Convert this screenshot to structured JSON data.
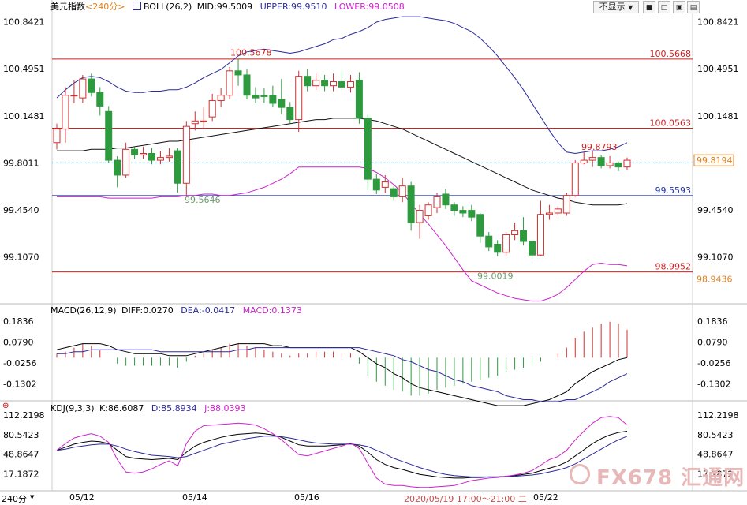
{
  "header": {
    "symbol": "美元指数",
    "period": "<240分>",
    "indicator": "BOLL(26,2)",
    "mid": "MID:99.5009",
    "upper": "UPPER:99.9510",
    "lower": "LOWER:99.0508"
  },
  "controls": {
    "dropdown_label": "不显示",
    "btn_a": "■",
    "btn_b": "□",
    "btn_c": "▣",
    "btn_d": "▤"
  },
  "main_axis": {
    "left_ticks": [
      "100.8421",
      "100.4951",
      "100.1481",
      "99.8011",
      "99.4540",
      "99.1070"
    ],
    "right_ticks": [
      "100.8421",
      "100.4951",
      "100.1481",
      "99.8011",
      "99.4540",
      "99.1070"
    ],
    "current_price": "99.8194",
    "lower_price": "98.9436"
  },
  "annotations": {
    "high": "100.5678",
    "low1": "99.5646",
    "low2": "99.0019",
    "peak": "99.8793",
    "line_100_5668": "100.5668",
    "line_100_0563": "100.0563",
    "line_99_5593": "99.5593",
    "line_98_9952": "98.9952"
  },
  "macd": {
    "title": "MACD(26,12,9)",
    "diff": "DIFF:0.0270",
    "dea": "DEA:-0.0417",
    "macd": "MACD:0.1373",
    "ticks": [
      "0.1836",
      "0.0790",
      "-0.0256",
      "-0.1302"
    ]
  },
  "kdj": {
    "title": "KDJ(9,3,3)",
    "k": "K:86.6087",
    "d": "D:85.8934",
    "j": "J:88.0393",
    "ticks": [
      "112.2198",
      "80.5423",
      "48.8647",
      "17.1872"
    ]
  },
  "time_axis": {
    "period": "240分",
    "labels": [
      "05/12",
      "05/14",
      "05/16",
      "05/22"
    ],
    "cursor_time": "2020/05/19 17:00～21:00 二"
  },
  "watermark": "FX678 汇通网",
  "colors": {
    "up": "#d03030",
    "down": "#2e9a3e",
    "upper_band": "#2a2a9a",
    "lower_band": "#cc22cc",
    "mid_band": "#111111",
    "level_red": "#cc2222",
    "level_blue": "#2233aa",
    "current": "#e08020"
  },
  "chart_data": {
    "type": "candlestick",
    "price_axis": {
      "min": 98.76,
      "max": 100.91
    },
    "candles": [
      [
        99.95,
        100.05,
        99.9,
        100.09
      ],
      [
        100.05,
        100.3,
        99.95,
        100.36
      ],
      [
        100.3,
        100.3,
        100.24,
        100.41
      ],
      [
        100.28,
        100.42,
        100.24,
        100.45
      ],
      [
        100.42,
        100.32,
        100.29,
        100.46
      ],
      [
        100.32,
        100.22,
        100.15,
        100.36
      ],
      [
        100.18,
        99.82,
        99.8,
        100.22
      ],
      [
        99.82,
        99.71,
        99.62,
        99.85
      ],
      [
        99.71,
        99.9,
        99.69,
        99.95
      ],
      [
        99.9,
        99.86,
        99.83,
        99.92
      ],
      [
        99.86,
        99.87,
        99.83,
        99.92
      ],
      [
        99.87,
        99.82,
        99.79,
        99.91
      ],
      [
        99.82,
        99.84,
        99.79,
        99.89
      ],
      [
        99.84,
        99.85,
        99.81,
        99.91
      ],
      [
        99.89,
        99.65,
        99.58,
        99.91
      ],
      [
        99.65,
        100.07,
        99.56,
        100.11
      ],
      [
        100.09,
        100.11,
        100.04,
        100.18
      ],
      [
        100.11,
        100.11,
        100.06,
        100.21
      ],
      [
        100.14,
        100.26,
        100.11,
        100.31
      ],
      [
        100.26,
        100.3,
        100.21,
        100.35
      ],
      [
        100.3,
        100.48,
        100.27,
        100.51
      ],
      [
        100.48,
        100.45,
        100.37,
        100.57
      ],
      [
        100.45,
        100.3,
        100.27,
        100.49
      ],
      [
        100.3,
        100.28,
        100.24,
        100.36
      ],
      [
        100.3,
        100.29,
        100.24,
        100.35
      ],
      [
        100.3,
        100.24,
        100.21,
        100.37
      ],
      [
        100.27,
        100.21,
        100.16,
        100.42
      ],
      [
        100.21,
        100.12,
        100.09,
        100.25
      ],
      [
        100.12,
        100.44,
        100.03,
        100.48
      ],
      [
        100.44,
        100.37,
        100.33,
        100.49
      ],
      [
        100.37,
        100.41,
        100.34,
        100.46
      ],
      [
        100.41,
        100.37,
        100.33,
        100.45
      ],
      [
        100.37,
        100.4,
        100.33,
        100.46
      ],
      [
        100.4,
        100.36,
        100.34,
        100.49
      ],
      [
        100.36,
        100.4,
        100.32,
        100.45
      ],
      [
        100.41,
        100.13,
        100.09,
        100.47
      ],
      [
        100.13,
        99.68,
        99.6,
        100.16
      ],
      [
        99.68,
        99.6,
        99.57,
        99.72
      ],
      [
        99.62,
        99.66,
        99.58,
        99.71
      ],
      [
        99.61,
        99.55,
        99.52,
        99.63
      ],
      [
        99.55,
        99.63,
        99.51,
        99.69
      ],
      [
        99.63,
        99.36,
        99.3,
        99.66
      ],
      [
        99.36,
        99.45,
        99.24,
        99.49
      ],
      [
        99.41,
        99.49,
        99.38,
        99.51
      ],
      [
        99.47,
        99.55,
        99.43,
        99.58
      ],
      [
        99.57,
        99.49,
        99.46,
        99.61
      ],
      [
        99.49,
        99.45,
        99.41,
        99.51
      ],
      [
        99.45,
        99.43,
        99.4,
        99.48
      ],
      [
        99.45,
        99.4,
        99.37,
        99.49
      ],
      [
        99.42,
        99.26,
        99.21,
        99.43
      ],
      [
        99.26,
        99.18,
        99.15,
        99.29
      ],
      [
        99.2,
        99.14,
        99.11,
        99.23
      ],
      [
        99.14,
        99.27,
        99.11,
        99.29
      ],
      [
        99.27,
        99.3,
        99.23,
        99.36
      ],
      [
        99.3,
        99.22,
        99.19,
        99.4
      ],
      [
        99.22,
        99.12,
        99.09,
        99.23
      ],
      [
        99.12,
        99.42,
        99.11,
        99.52
      ],
      [
        99.42,
        99.43,
        99.38,
        99.49
      ],
      [
        99.43,
        99.46,
        99.41,
        99.48
      ],
      [
        99.43,
        99.56,
        99.41,
        99.58
      ],
      [
        99.56,
        99.8,
        99.55,
        99.82
      ],
      [
        99.8,
        99.82,
        99.79,
        99.88
      ],
      [
        99.82,
        99.84,
        99.77,
        99.89
      ],
      [
        99.84,
        99.78,
        99.76,
        99.86
      ],
      [
        99.78,
        99.8,
        99.76,
        99.85
      ],
      [
        99.8,
        99.77,
        99.74,
        99.81
      ],
      [
        99.77,
        99.82,
        99.75,
        99.84
      ]
    ],
    "upper_band": [
      100.28,
      100.34,
      100.39,
      100.43,
      100.44,
      100.43,
      100.4,
      100.36,
      100.33,
      100.32,
      100.32,
      100.33,
      100.33,
      100.34,
      100.34,
      100.36,
      100.39,
      100.43,
      100.46,
      100.49,
      100.54,
      100.59,
      100.62,
      100.63,
      100.64,
      100.63,
      100.62,
      100.61,
      100.62,
      100.64,
      100.66,
      100.68,
      100.71,
      100.72,
      100.75,
      100.77,
      100.8,
      100.84,
      100.86,
      100.87,
      100.88,
      100.88,
      100.88,
      100.87,
      100.86,
      100.85,
      100.83,
      100.8,
      100.77,
      100.72,
      100.66,
      100.59,
      100.51,
      100.43,
      100.34,
      100.24,
      100.14,
      100.04,
      99.95,
      99.88,
      99.87,
      99.88,
      99.89,
      99.89,
      99.9,
      99.92,
      99.95
    ],
    "mid_band": [
      99.89,
      99.89,
      99.89,
      99.89,
      99.9,
      99.9,
      99.9,
      99.91,
      99.91,
      99.92,
      99.93,
      99.94,
      99.95,
      99.96,
      99.96,
      99.97,
      99.98,
      99.99,
      100.0,
      100.01,
      100.02,
      100.03,
      100.04,
      100.05,
      100.06,
      100.07,
      100.08,
      100.09,
      100.1,
      100.11,
      100.12,
      100.12,
      100.13,
      100.13,
      100.13,
      100.13,
      100.12,
      100.11,
      100.09,
      100.07,
      100.05,
      100.02,
      99.99,
      99.96,
      99.93,
      99.9,
      99.87,
      99.84,
      99.81,
      99.78,
      99.75,
      99.72,
      99.69,
      99.66,
      99.63,
      99.6,
      99.58,
      99.56,
      99.54,
      99.53,
      99.51,
      99.5,
      99.49,
      99.49,
      99.49,
      99.49,
      99.5
    ],
    "lower_band": [
      99.55,
      99.55,
      99.55,
      99.55,
      99.55,
      99.55,
      99.54,
      99.54,
      99.54,
      99.54,
      99.54,
      99.54,
      99.55,
      99.55,
      99.55,
      99.56,
      99.56,
      99.57,
      99.57,
      99.56,
      99.56,
      99.57,
      99.58,
      99.6,
      99.62,
      99.65,
      99.68,
      99.72,
      99.77,
      99.77,
      99.77,
      99.77,
      99.77,
      99.77,
      99.77,
      99.77,
      99.76,
      99.73,
      99.69,
      99.64,
      99.58,
      99.5,
      99.42,
      99.35,
      99.27,
      99.19,
      99.1,
      99.01,
      98.93,
      98.9,
      98.87,
      98.84,
      98.82,
      98.8,
      98.79,
      98.78,
      98.78,
      98.8,
      98.83,
      98.88,
      98.94,
      99.0,
      99.05,
      99.06,
      99.05,
      99.05,
      99.04
    ],
    "macd_hist": [
      0.02,
      0.03,
      0.05,
      0.07,
      0.06,
      0.04,
      0.0,
      -0.03,
      -0.04,
      -0.04,
      -0.04,
      -0.04,
      -0.04,
      -0.04,
      -0.05,
      -0.02,
      0.01,
      0.02,
      0.04,
      0.05,
      0.07,
      0.07,
      0.06,
      0.05,
      0.04,
      0.03,
      0.02,
      0.01,
      0.02,
      0.02,
      0.03,
      0.03,
      0.03,
      0.02,
      0.02,
      -0.03,
      -0.09,
      -0.12,
      -0.14,
      -0.16,
      -0.17,
      -0.19,
      -0.19,
      -0.18,
      -0.16,
      -0.15,
      -0.14,
      -0.13,
      -0.12,
      -0.11,
      -0.1,
      -0.09,
      -0.07,
      -0.06,
      -0.05,
      -0.04,
      -0.02,
      0.0,
      0.02,
      0.05,
      0.1,
      0.13,
      0.15,
      0.17,
      0.18,
      0.17,
      0.14
    ],
    "macd_diff": [
      0.04,
      0.05,
      0.06,
      0.07,
      0.07,
      0.07,
      0.06,
      0.04,
      0.03,
      0.02,
      0.02,
      0.02,
      0.02,
      0.01,
      0.01,
      0.01,
      0.02,
      0.03,
      0.04,
      0.05,
      0.06,
      0.07,
      0.07,
      0.07,
      0.07,
      0.06,
      0.06,
      0.05,
      0.05,
      0.05,
      0.05,
      0.05,
      0.05,
      0.05,
      0.05,
      0.03,
      0.0,
      -0.03,
      -0.05,
      -0.08,
      -0.1,
      -0.13,
      -0.15,
      -0.16,
      -0.17,
      -0.18,
      -0.19,
      -0.2,
      -0.21,
      -0.22,
      -0.23,
      -0.24,
      -0.24,
      -0.24,
      -0.24,
      -0.23,
      -0.22,
      -0.21,
      -0.19,
      -0.17,
      -0.13,
      -0.1,
      -0.07,
      -0.05,
      -0.03,
      -0.01,
      0.0
    ],
    "macd_dea": [
      0.02,
      0.02,
      0.03,
      0.03,
      0.04,
      0.04,
      0.04,
      0.04,
      0.04,
      0.04,
      0.04,
      0.04,
      0.03,
      0.03,
      0.03,
      0.03,
      0.03,
      0.03,
      0.03,
      0.03,
      0.03,
      0.04,
      0.04,
      0.05,
      0.05,
      0.05,
      0.05,
      0.05,
      0.05,
      0.05,
      0.05,
      0.05,
      0.05,
      0.05,
      0.05,
      0.05,
      0.04,
      0.03,
      0.02,
      0.01,
      -0.01,
      -0.02,
      -0.04,
      -0.06,
      -0.07,
      -0.09,
      -0.11,
      -0.12,
      -0.14,
      -0.15,
      -0.16,
      -0.17,
      -0.19,
      -0.2,
      -0.21,
      -0.21,
      -0.22,
      -0.22,
      -0.22,
      -0.21,
      -0.21,
      -0.19,
      -0.17,
      -0.15,
      -0.12,
      -0.1,
      -0.08
    ],
    "kdj_k": [
      55,
      60,
      65,
      68,
      70,
      69,
      66,
      55,
      45,
      42,
      41,
      40,
      41,
      42,
      40,
      52,
      62,
      68,
      72,
      76,
      79,
      81,
      82,
      83,
      82,
      80,
      76,
      70,
      64,
      62,
      62,
      62,
      63,
      64,
      66,
      62,
      52,
      40,
      32,
      27,
      24,
      20,
      16,
      14,
      12,
      11,
      10,
      10,
      11,
      11,
      12,
      12,
      13,
      14,
      16,
      18,
      22,
      26,
      30,
      36,
      46,
      56,
      66,
      74,
      80,
      84,
      86
    ],
    "kdj_d": [
      55,
      57,
      60,
      62,
      64,
      65,
      65,
      62,
      57,
      53,
      50,
      47,
      46,
      45,
      43,
      45,
      50,
      55,
      60,
      65,
      68,
      71,
      74,
      76,
      78,
      78,
      77,
      75,
      72,
      69,
      67,
      66,
      65,
      65,
      65,
      64,
      61,
      55,
      49,
      42,
      37,
      32,
      27,
      23,
      19,
      16,
      14,
      13,
      12,
      12,
      12,
      12,
      12,
      13,
      14,
      15,
      17,
      20,
      23,
      27,
      33,
      41,
      49,
      57,
      65,
      72,
      78
    ],
    "kdj_j": [
      55,
      66,
      75,
      79,
      82,
      78,
      68,
      40,
      20,
      18,
      20,
      25,
      32,
      38,
      30,
      66,
      86,
      95,
      96,
      97,
      98,
      99,
      98,
      96,
      90,
      82,
      72,
      60,
      48,
      46,
      50,
      54,
      58,
      62,
      67,
      58,
      34,
      10,
      0,
      -2,
      -2,
      -4,
      -5,
      -5,
      -4,
      -3,
      -2,
      2,
      6,
      8,
      10,
      11,
      13,
      15,
      18,
      22,
      31,
      40,
      45,
      55,
      72,
      86,
      99,
      108,
      110,
      108,
      96
    ]
  }
}
